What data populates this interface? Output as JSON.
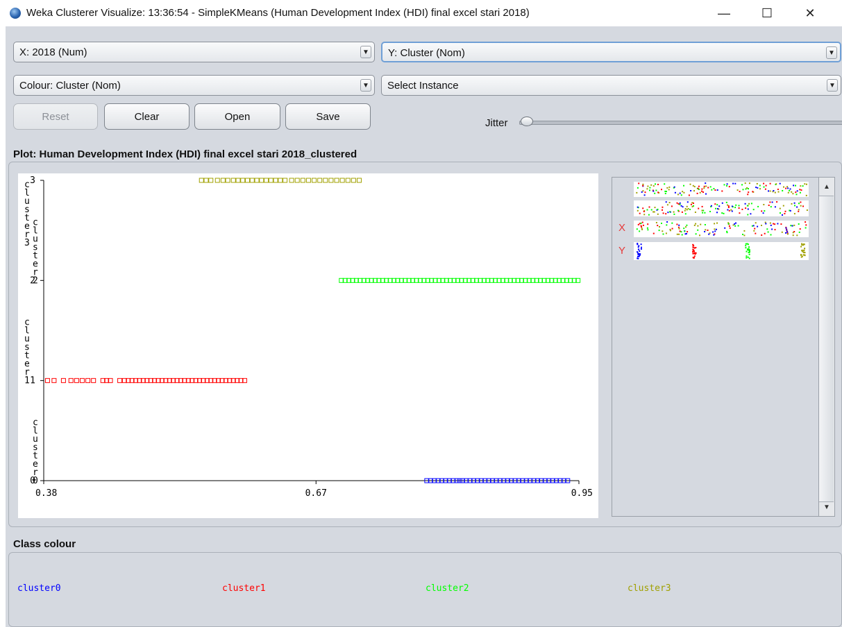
{
  "window": {
    "title": "Weka Clusterer Visualize: 13:36:54 - SimpleKMeans (Human Development Index (HDI) final excel stari 2018)",
    "minimize_glyph": "—",
    "maximize_glyph": "☐",
    "close_glyph": "✕"
  },
  "controls": {
    "x_axis": "X: 2018 (Num)",
    "y_axis": "Y: Cluster (Nom)",
    "colour": "Colour: Cluster (Nom)",
    "instance": "Select Instance",
    "dropdown_arrow": "▼",
    "buttons": {
      "reset": "Reset",
      "clear": "Clear",
      "open": "Open",
      "save": "Save"
    },
    "jitter_label": "Jitter",
    "jitter_value": 0
  },
  "plot": {
    "title": "Plot: Human Development Index (HDI) final excel stari 2018_clustered"
  },
  "attribute_panel": {
    "x_marker": "X",
    "y_marker": "Y",
    "scroll_up": "▲",
    "scroll_down": "▼"
  },
  "class_colour": {
    "title": "Class colour",
    "classes": [
      {
        "name": "cluster0",
        "color": "#0000ff"
      },
      {
        "name": "cluster1",
        "color": "#ff0000"
      },
      {
        "name": "cluster2",
        "color": "#00ff00"
      },
      {
        "name": "cluster3",
        "color": "#a0a000"
      }
    ]
  },
  "chart_data": {
    "type": "scatter",
    "xlabel": "2018",
    "ylabel": "Cluster",
    "xlim": [
      0.38,
      0.95
    ],
    "x_ticks": [
      "0.38",
      "0.67",
      "0.95"
    ],
    "y_categories": [
      "cluster0",
      "cluster1",
      "cluster2",
      "cluster3"
    ],
    "y_tick_labels": [
      "0",
      "1",
      "2",
      "3"
    ],
    "y_axis_vertical_text": [
      {
        "text": "cluster3",
        "level": 3
      },
      {
        "text": "cluster2",
        "level": 2
      },
      {
        "text": "cluster1",
        "level": 1
      },
      {
        "text": "cluster0",
        "level": 0
      }
    ],
    "series": [
      {
        "name": "cluster0",
        "color": "#0000ff",
        "x": [
          0.788,
          0.792,
          0.796,
          0.8,
          0.804,
          0.808,
          0.812,
          0.816,
          0.82,
          0.823,
          0.826,
          0.83,
          0.834,
          0.838,
          0.842,
          0.846,
          0.85,
          0.854,
          0.858,
          0.862,
          0.866,
          0.87,
          0.874,
          0.878,
          0.882,
          0.886,
          0.89,
          0.894,
          0.898,
          0.902,
          0.906,
          0.91,
          0.914,
          0.918,
          0.922,
          0.926,
          0.93,
          0.934,
          0.938
        ]
      },
      {
        "name": "cluster1",
        "color": "#ff0000",
        "x": [
          0.384,
          0.391,
          0.401,
          0.409,
          0.415,
          0.421,
          0.427,
          0.433,
          0.443,
          0.447,
          0.451,
          0.461,
          0.466,
          0.47,
          0.474,
          0.478,
          0.482,
          0.486,
          0.49,
          0.494,
          0.498,
          0.502,
          0.506,
          0.51,
          0.514,
          0.518,
          0.522,
          0.526,
          0.53,
          0.534,
          0.538,
          0.542,
          0.546,
          0.55,
          0.554,
          0.558,
          0.562,
          0.566,
          0.57,
          0.574,
          0.578,
          0.582,
          0.586,
          0.59,
          0.594
        ]
      },
      {
        "name": "cluster2",
        "color": "#00ff00",
        "x": [
          0.697,
          0.701,
          0.705,
          0.709,
          0.713,
          0.717,
          0.721,
          0.725,
          0.729,
          0.733,
          0.737,
          0.741,
          0.745,
          0.749,
          0.753,
          0.757,
          0.761,
          0.765,
          0.769,
          0.773,
          0.777,
          0.781,
          0.785,
          0.789,
          0.793,
          0.797,
          0.801,
          0.805,
          0.809,
          0.813,
          0.817,
          0.821,
          0.825,
          0.829,
          0.833,
          0.837,
          0.841,
          0.845,
          0.849,
          0.853,
          0.857,
          0.861,
          0.865,
          0.869,
          0.873,
          0.877,
          0.881,
          0.885,
          0.889,
          0.893,
          0.897,
          0.901,
          0.905,
          0.909,
          0.913,
          0.917,
          0.921,
          0.925,
          0.929,
          0.933,
          0.937,
          0.941,
          0.945,
          0.949
        ]
      },
      {
        "name": "cluster3",
        "color": "#a0a000",
        "x": [
          0.548,
          0.553,
          0.558,
          0.565,
          0.571,
          0.576,
          0.582,
          0.587,
          0.592,
          0.597,
          0.602,
          0.607,
          0.612,
          0.617,
          0.622,
          0.627,
          0.632,
          0.637,
          0.644,
          0.65,
          0.656,
          0.662,
          0.668,
          0.674,
          0.68,
          0.686,
          0.692,
          0.698,
          0.704,
          0.71,
          0.716
        ]
      }
    ]
  }
}
